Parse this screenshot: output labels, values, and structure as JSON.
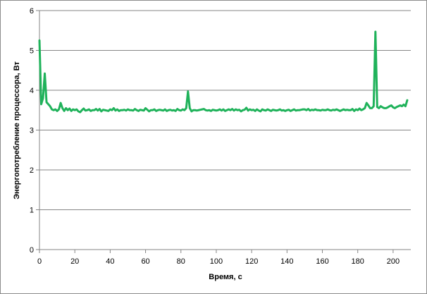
{
  "chart_data": {
    "type": "line",
    "title": "",
    "xlabel": "Время, с",
    "ylabel": "Энергопотребление процессора, Вт",
    "xlim": [
      0,
      210
    ],
    "ylim": [
      0,
      6
    ],
    "x_ticks": [
      0,
      20,
      40,
      60,
      80,
      100,
      120,
      140,
      160,
      180,
      200
    ],
    "y_ticks": [
      0,
      1,
      2,
      3,
      4,
      5,
      6
    ],
    "grid": "horizontal",
    "legend": "none",
    "series": [
      {
        "color": "#1fb25a",
        "points": [
          [
            0,
            5.25
          ],
          [
            1,
            3.65
          ],
          [
            2,
            3.8
          ],
          [
            3,
            4.42
          ],
          [
            4,
            3.7
          ],
          [
            5,
            3.65
          ],
          [
            6,
            3.6
          ],
          [
            7,
            3.52
          ],
          [
            8,
            3.5
          ],
          [
            9,
            3.52
          ],
          [
            10,
            3.48
          ],
          [
            11,
            3.52
          ],
          [
            12,
            3.68
          ],
          [
            13,
            3.55
          ],
          [
            14,
            3.48
          ],
          [
            15,
            3.55
          ],
          [
            16,
            3.5
          ],
          [
            17,
            3.54
          ],
          [
            18,
            3.48
          ],
          [
            19,
            3.52
          ],
          [
            20,
            3.5
          ],
          [
            21,
            3.52
          ],
          [
            22,
            3.47
          ],
          [
            23,
            3.45
          ],
          [
            24,
            3.5
          ],
          [
            25,
            3.54
          ],
          [
            26,
            3.49
          ],
          [
            27,
            3.5
          ],
          [
            28,
            3.52
          ],
          [
            29,
            3.48
          ],
          [
            30,
            3.5
          ],
          [
            31,
            3.5
          ],
          [
            32,
            3.53
          ],
          [
            33,
            3.49
          ],
          [
            34,
            3.53
          ],
          [
            35,
            3.47
          ],
          [
            36,
            3.51
          ],
          [
            37,
            3.5
          ],
          [
            38,
            3.49
          ],
          [
            39,
            3.48
          ],
          [
            40,
            3.52
          ],
          [
            41,
            3.5
          ],
          [
            42,
            3.55
          ],
          [
            43,
            3.49
          ],
          [
            44,
            3.52
          ],
          [
            45,
            3.48
          ],
          [
            46,
            3.5
          ],
          [
            47,
            3.5
          ],
          [
            48,
            3.51
          ],
          [
            49,
            3.49
          ],
          [
            50,
            3.52
          ],
          [
            51,
            3.5
          ],
          [
            52,
            3.5
          ],
          [
            53,
            3.49
          ],
          [
            54,
            3.53
          ],
          [
            55,
            3.5
          ],
          [
            56,
            3.48
          ],
          [
            57,
            3.51
          ],
          [
            58,
            3.5
          ],
          [
            59,
            3.49
          ],
          [
            60,
            3.55
          ],
          [
            61,
            3.51
          ],
          [
            62,
            3.47
          ],
          [
            63,
            3.5
          ],
          [
            64,
            3.5
          ],
          [
            65,
            3.52
          ],
          [
            66,
            3.48
          ],
          [
            67,
            3.5
          ],
          [
            68,
            3.51
          ],
          [
            69,
            3.5
          ],
          [
            70,
            3.49
          ],
          [
            71,
            3.52
          ],
          [
            72,
            3.48
          ],
          [
            73,
            3.5
          ],
          [
            74,
            3.51
          ],
          [
            75,
            3.49
          ],
          [
            76,
            3.5
          ],
          [
            77,
            3.48
          ],
          [
            78,
            3.53
          ],
          [
            79,
            3.5
          ],
          [
            80,
            3.49
          ],
          [
            81,
            3.52
          ],
          [
            82,
            3.5
          ],
          [
            83,
            3.55
          ],
          [
            84,
            3.97
          ],
          [
            85,
            3.55
          ],
          [
            86,
            3.47
          ],
          [
            87,
            3.5
          ],
          [
            88,
            3.5
          ],
          [
            89,
            3.49
          ],
          [
            90,
            3.5
          ],
          [
            91,
            3.51
          ],
          [
            92,
            3.52
          ],
          [
            93,
            3.53
          ],
          [
            94,
            3.5
          ],
          [
            95,
            3.49
          ],
          [
            96,
            3.5
          ],
          [
            97,
            3.48
          ],
          [
            98,
            3.51
          ],
          [
            99,
            3.5
          ],
          [
            100,
            3.49
          ],
          [
            101,
            3.5
          ],
          [
            102,
            3.52
          ],
          [
            103,
            3.49
          ],
          [
            104,
            3.52
          ],
          [
            105,
            3.48
          ],
          [
            106,
            3.5
          ],
          [
            107,
            3.52
          ],
          [
            108,
            3.5
          ],
          [
            109,
            3.53
          ],
          [
            110,
            3.49
          ],
          [
            111,
            3.52
          ],
          [
            112,
            3.5
          ],
          [
            113,
            3.51
          ],
          [
            114,
            3.47
          ],
          [
            115,
            3.5
          ],
          [
            116,
            3.51
          ],
          [
            117,
            3.56
          ],
          [
            118,
            3.49
          ],
          [
            119,
            3.52
          ],
          [
            120,
            3.5
          ],
          [
            121,
            3.51
          ],
          [
            122,
            3.48
          ],
          [
            123,
            3.52
          ],
          [
            124,
            3.49
          ],
          [
            125,
            3.47
          ],
          [
            126,
            3.52
          ],
          [
            127,
            3.5
          ],
          [
            128,
            3.49
          ],
          [
            129,
            3.52
          ],
          [
            130,
            3.5
          ],
          [
            131,
            3.48
          ],
          [
            132,
            3.51
          ],
          [
            133,
            3.5
          ],
          [
            134,
            3.49
          ],
          [
            135,
            3.5
          ],
          [
            136,
            3.52
          ],
          [
            137,
            3.49
          ],
          [
            138,
            3.5
          ],
          [
            139,
            3.48
          ],
          [
            140,
            3.5
          ],
          [
            141,
            3.51
          ],
          [
            142,
            3.48
          ],
          [
            143,
            3.5
          ],
          [
            144,
            3.52
          ],
          [
            145,
            3.49
          ],
          [
            146,
            3.5
          ],
          [
            147,
            3.5
          ],
          [
            148,
            3.51
          ],
          [
            149,
            3.52
          ],
          [
            150,
            3.52
          ],
          [
            151,
            3.5
          ],
          [
            152,
            3.53
          ],
          [
            153,
            3.49
          ],
          [
            154,
            3.51
          ],
          [
            155,
            3.5
          ],
          [
            156,
            3.52
          ],
          [
            157,
            3.5
          ],
          [
            158,
            3.5
          ],
          [
            159,
            3.49
          ],
          [
            160,
            3.51
          ],
          [
            161,
            3.5
          ],
          [
            162,
            3.5
          ],
          [
            163,
            3.52
          ],
          [
            164,
            3.5
          ],
          [
            165,
            3.49
          ],
          [
            166,
            3.51
          ],
          [
            167,
            3.5
          ],
          [
            168,
            3.52
          ],
          [
            169,
            3.5
          ],
          [
            170,
            3.48
          ],
          [
            171,
            3.5
          ],
          [
            172,
            3.52
          ],
          [
            173,
            3.5
          ],
          [
            174,
            3.51
          ],
          [
            175,
            3.5
          ],
          [
            176,
            3.5
          ],
          [
            177,
            3.53
          ],
          [
            178,
            3.48
          ],
          [
            179,
            3.52
          ],
          [
            180,
            3.5
          ],
          [
            181,
            3.54
          ],
          [
            182,
            3.5
          ],
          [
            183,
            3.52
          ],
          [
            184,
            3.55
          ],
          [
            185,
            3.68
          ],
          [
            186,
            3.62
          ],
          [
            187,
            3.55
          ],
          [
            188,
            3.55
          ],
          [
            189,
            3.6
          ],
          [
            190,
            5.47
          ],
          [
            191,
            3.58
          ],
          [
            192,
            3.55
          ],
          [
            193,
            3.6
          ],
          [
            194,
            3.57
          ],
          [
            195,
            3.55
          ],
          [
            196,
            3.55
          ],
          [
            197,
            3.57
          ],
          [
            198,
            3.6
          ],
          [
            199,
            3.62
          ],
          [
            200,
            3.57
          ],
          [
            201,
            3.55
          ],
          [
            202,
            3.58
          ],
          [
            203,
            3.6
          ],
          [
            204,
            3.62
          ],
          [
            205,
            3.6
          ],
          [
            206,
            3.64
          ],
          [
            207,
            3.6
          ],
          [
            208,
            3.75
          ]
        ]
      }
    ]
  }
}
